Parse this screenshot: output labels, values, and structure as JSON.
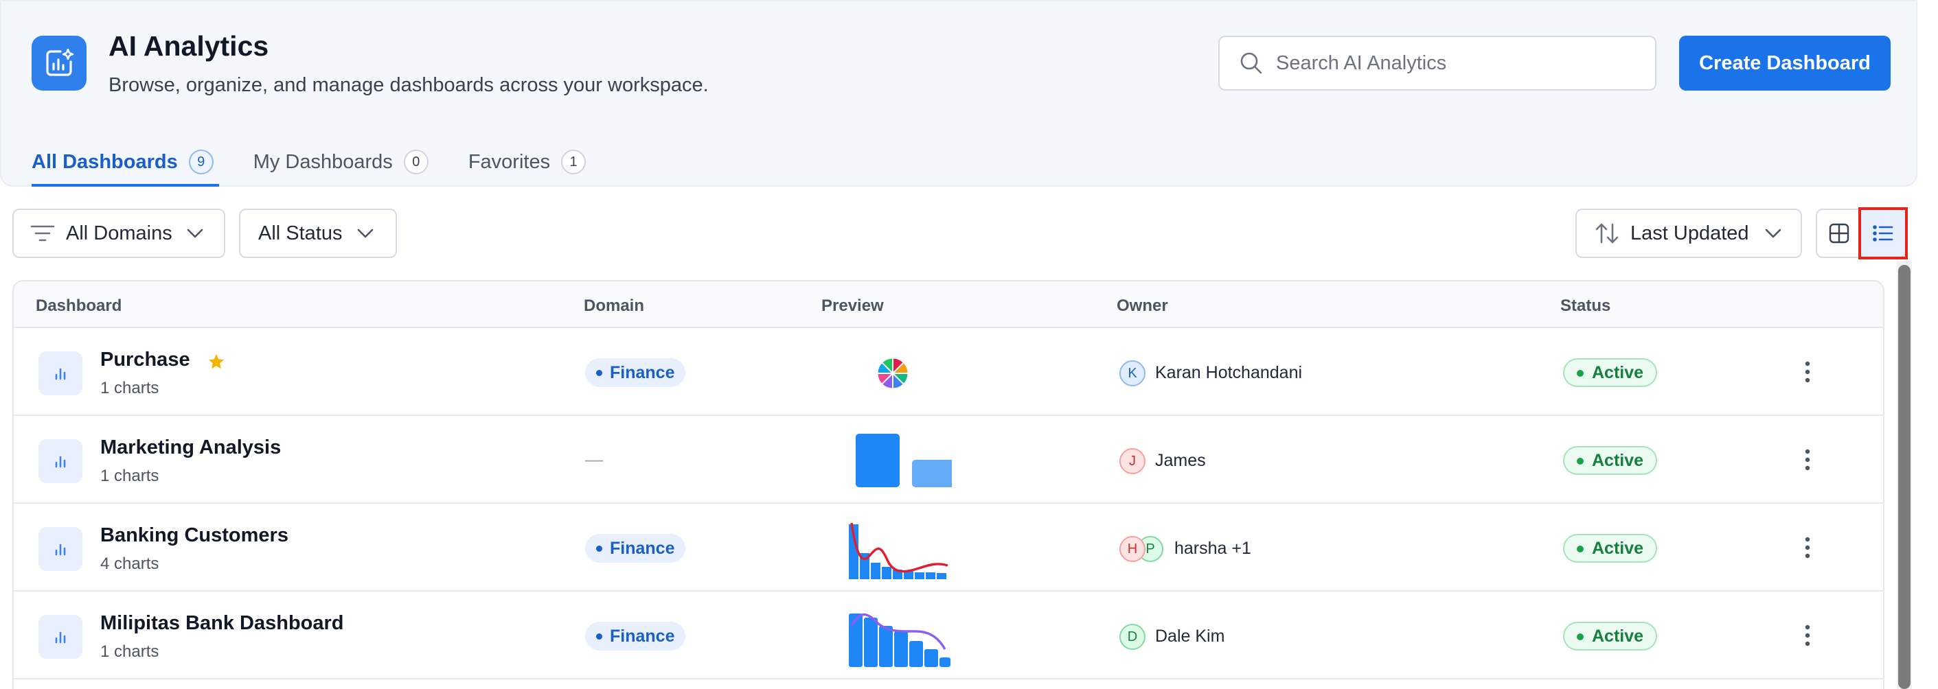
{
  "header": {
    "title": "AI Analytics",
    "subtitle": "Browse, organize, and manage dashboards across your workspace.",
    "search_placeholder": "Search AI Analytics",
    "create_label": "Create Dashboard",
    "app_icon": "analytics-sparkle-icon"
  },
  "tabs": [
    {
      "label": "All Dashboards",
      "count": "9",
      "active": true
    },
    {
      "label": "My Dashboards",
      "count": "0",
      "active": false
    },
    {
      "label": "Favorites",
      "count": "1",
      "active": false
    }
  ],
  "filters": {
    "domain_label": "All Domains",
    "status_label": "All Status",
    "sort_label": "Last Updated",
    "view_mode": "list"
  },
  "table": {
    "headers": {
      "dashboard": "Dashboard",
      "domain": "Domain",
      "preview": "Preview",
      "owner": "Owner",
      "status": "Status"
    },
    "rows": [
      {
        "name": "Purchase",
        "charts": "1 charts",
        "favorite": true,
        "domain": "Finance",
        "preview": "pie",
        "owner_initials": [
          "K"
        ],
        "owner": "Karan Hotchandani",
        "status": "Active"
      },
      {
        "name": "Marketing Analysis",
        "charts": "1 charts",
        "favorite": false,
        "domain": "—",
        "preview": "bars",
        "owner_initials": [
          "J"
        ],
        "owner": "James",
        "status": "Active"
      },
      {
        "name": "Banking Customers",
        "charts": "4 charts",
        "favorite": false,
        "domain": "Finance",
        "preview": "bar-line-red",
        "owner_initials": [
          "H",
          "P"
        ],
        "owner": "harsha +1",
        "status": "Active"
      },
      {
        "name": "Milipitas Bank Dashboard",
        "charts": "1 charts",
        "favorite": false,
        "domain": "Finance",
        "preview": "bar-line-purple",
        "owner_initials": [
          "D"
        ],
        "owner": "Dale Kim",
        "status": "Active"
      }
    ]
  },
  "colors": {
    "accent": "#1a73e8",
    "status_active": "#15803d",
    "highlight": "#e3241b"
  }
}
